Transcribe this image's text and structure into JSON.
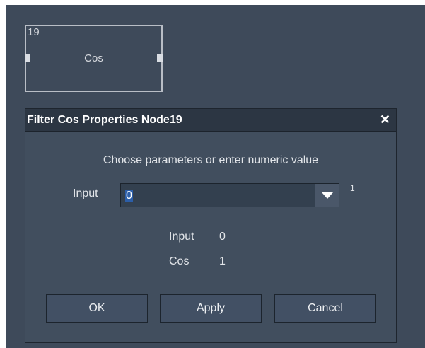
{
  "node": {
    "id": "19",
    "label": "Cos"
  },
  "dialog": {
    "title": "Filter Cos Properties Node19",
    "close_icon": "close-icon",
    "instruction": "Choose parameters or enter numeric value",
    "input_label": "Input",
    "input_value": "0",
    "dropdown_icon": "chevron-down-icon",
    "superscript": "1",
    "values": [
      {
        "name": "Input",
        "value": "0"
      },
      {
        "name": "Cos",
        "value": "1"
      }
    ],
    "buttons": {
      "ok": "OK",
      "apply": "Apply",
      "cancel": "Cancel"
    }
  },
  "colors": {
    "canvas_bg": "#3e4a5a",
    "titlebar_bg": "#2c3643",
    "dialog_bg": "#414e5e",
    "selection": "#2c5ea8"
  }
}
